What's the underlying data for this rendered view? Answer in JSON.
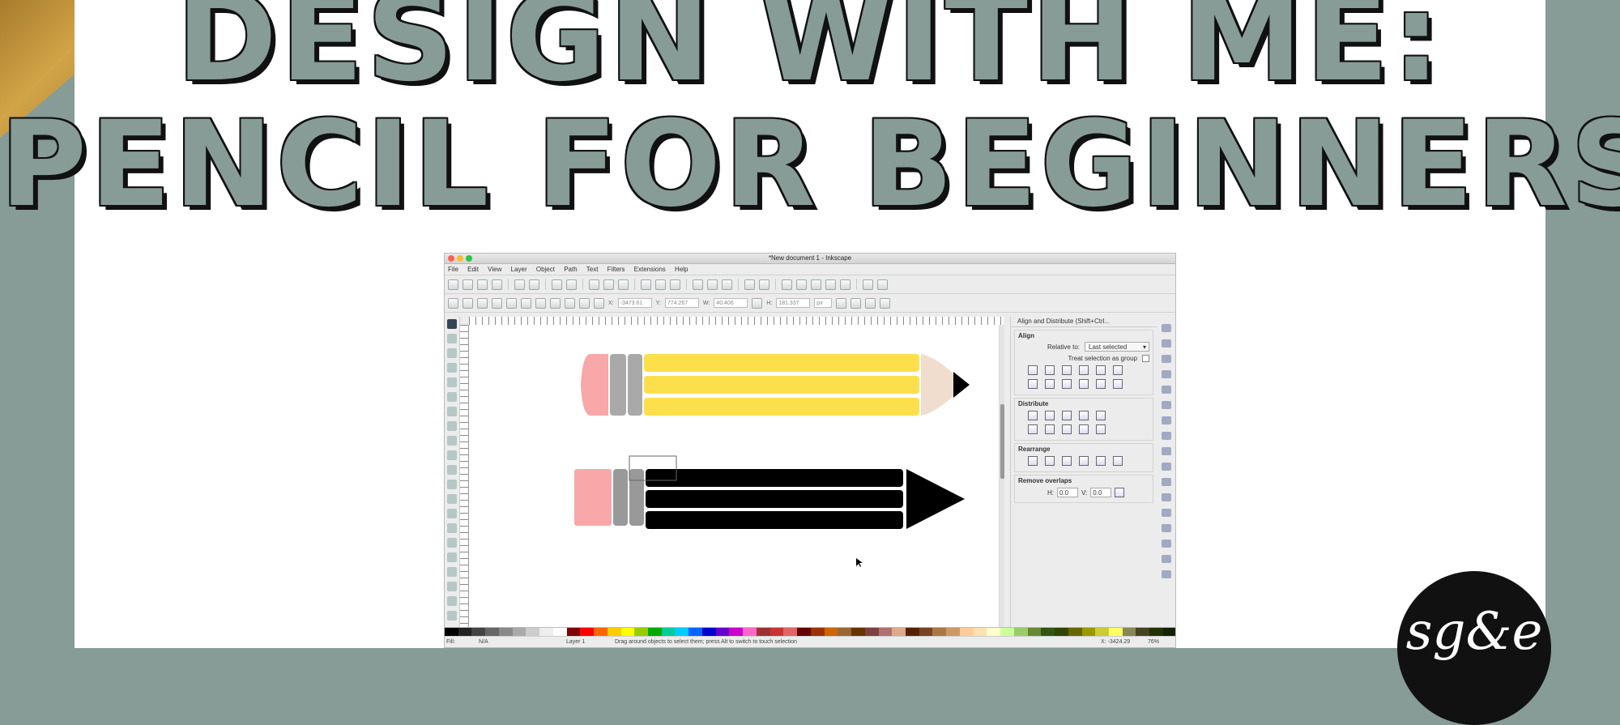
{
  "page": {
    "title_line1": "DESIGN WITH ME:",
    "title_line2": "PENCIL FOR BEGINNERS",
    "logo_text": "sg&e"
  },
  "window": {
    "title": "*New document 1 - Inkscape",
    "menu": [
      "File",
      "Edit",
      "View",
      "Layer",
      "Object",
      "Path",
      "Text",
      "Filters",
      "Extensions",
      "Help"
    ]
  },
  "controls": {
    "x_label": "X:",
    "x_value": "-3473.61",
    "y_label": "Y:",
    "y_value": "774.267",
    "w_label": "W:",
    "w_value": "40.406",
    "h_label": "H:",
    "h_value": "181.337",
    "unit": "px"
  },
  "panel": {
    "title": "Align and Distribute (Shift+Ctrl...",
    "align_heading": "Align",
    "relative_label": "Relative to:",
    "relative_value": "Last selected",
    "treat_group": "Treat selection as group",
    "distribute_heading": "Distribute",
    "rearrange_heading": "Rearrange",
    "remove_overlaps_heading": "Remove overlaps",
    "h_label": "H:",
    "h_value": "0.0",
    "v_label": "V:",
    "v_value": "0.0"
  },
  "status": {
    "fill_label": "Fill:",
    "fill_value": "N/A",
    "layer": "Layer 1",
    "message": "Drag around objects to select them; press Alt to switch to touch selection",
    "coords": "X: -3424.29",
    "zoom": "76%"
  },
  "colors": {
    "background": "#879c97",
    "pencil_yellow": "#fddf4c",
    "pencil_black": "#000000",
    "eraser_pink": "#f8a8a8",
    "ferrule_gray": "#a9a9a9",
    "wood_tip": "#f0ddcd"
  },
  "palette": [
    "#000000",
    "#222222",
    "#444444",
    "#666666",
    "#888888",
    "#aaaaaa",
    "#cccccc",
    "#eeeeee",
    "#ffffff",
    "#800000",
    "#ff0000",
    "#ff6600",
    "#ffcc00",
    "#ffff00",
    "#99cc00",
    "#00aa00",
    "#00cc99",
    "#00ccff",
    "#0066ff",
    "#0000cc",
    "#6600cc",
    "#cc00cc",
    "#ff66cc",
    "#993333",
    "#cc3333",
    "#e06666",
    "#660000",
    "#993300",
    "#cc6600",
    "#996633",
    "#663300",
    "#804040",
    "#b07070",
    "#ddaa88",
    "#552200",
    "#774422",
    "#aa7744",
    "#cc9966",
    "#ffcc99",
    "#ffe0b0",
    "#ffffcc",
    "#ccff99",
    "#99cc66",
    "#668833",
    "#335511",
    "#334400",
    "#666600",
    "#999900",
    "#cccc33",
    "#ffff66",
    "#888855",
    "#444422",
    "#223300",
    "#112200"
  ]
}
